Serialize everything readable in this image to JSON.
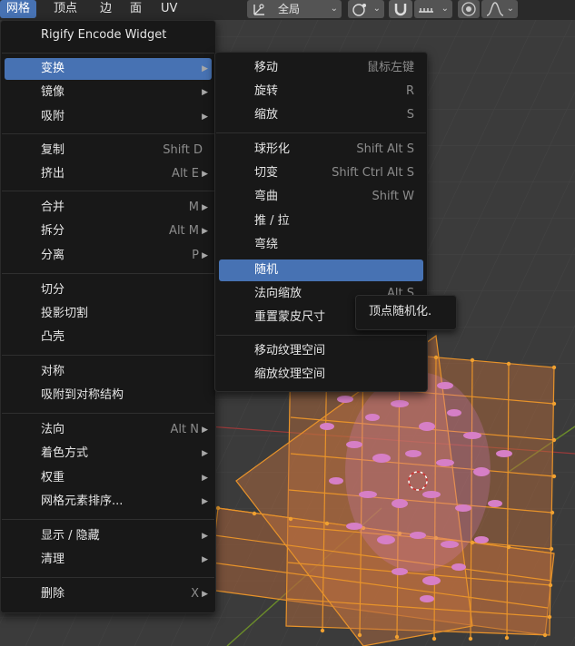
{
  "header": {
    "menu_items": [
      "网格",
      "顶点",
      "边",
      "面",
      "UV"
    ],
    "transform_orientation": "全局",
    "icons": [
      "transform-pivot-icon",
      "snap-icon",
      "magnet-icon",
      "snap-increment-icon",
      "proportional-edit-icon",
      "falloff-curve-icon"
    ]
  },
  "mesh_menu": {
    "items": [
      {
        "label": "Rigify Encode Widget",
        "shortcut": ""
      },
      {
        "label": "变换",
        "shortcut": ""
      },
      {
        "label": "镜像",
        "shortcut": ""
      },
      {
        "label": "吸附",
        "shortcut": ""
      },
      {
        "label": "复制",
        "shortcut": "Shift D"
      },
      {
        "label": "挤出",
        "shortcut": "Alt E"
      },
      {
        "label": "合并",
        "shortcut": "M"
      },
      {
        "label": "拆分",
        "shortcut": "Alt M"
      },
      {
        "label": "分离",
        "shortcut": "P"
      },
      {
        "label": "切分",
        "shortcut": ""
      },
      {
        "label": "投影切割",
        "shortcut": ""
      },
      {
        "label": "凸壳",
        "shortcut": ""
      },
      {
        "label": "对称",
        "shortcut": ""
      },
      {
        "label": "吸附到对称结构",
        "shortcut": ""
      },
      {
        "label": "法向",
        "shortcut": "Alt N"
      },
      {
        "label": "着色方式",
        "shortcut": ""
      },
      {
        "label": "权重",
        "shortcut": ""
      },
      {
        "label": "网格元素排序...",
        "shortcut": ""
      },
      {
        "label": "显示 / 隐藏",
        "shortcut": ""
      },
      {
        "label": "清理",
        "shortcut": ""
      },
      {
        "label": "删除",
        "shortcut": "X"
      }
    ]
  },
  "transform_submenu": {
    "items": [
      {
        "label": "移动",
        "shortcut": "鼠标左键"
      },
      {
        "label": "旋转",
        "shortcut": "R"
      },
      {
        "label": "缩放",
        "shortcut": "S"
      },
      {
        "label": "球形化",
        "shortcut": "Shift Alt S"
      },
      {
        "label": "切变",
        "shortcut": "Shift Ctrl Alt S"
      },
      {
        "label": "弯曲",
        "shortcut": "Shift W"
      },
      {
        "label": "推 / 拉",
        "shortcut": ""
      },
      {
        "label": "弯绕",
        "shortcut": ""
      },
      {
        "label": "随机",
        "shortcut": ""
      },
      {
        "label": "法向缩放",
        "shortcut": "Alt S"
      },
      {
        "label": "重置蒙皮尺寸",
        "shortcut": ""
      },
      {
        "label": "移动纹理空间",
        "shortcut": ""
      },
      {
        "label": "缩放纹理空间",
        "shortcut": ""
      }
    ]
  },
  "tooltip": {
    "text": "顶点随机化."
  },
  "colors": {
    "accent": "#4772b3",
    "menu_bg": "#181818",
    "mesh_orange": "#e8932a",
    "particles_pink": "#d67fc6",
    "viewport_bg": "#3b3b3b"
  }
}
